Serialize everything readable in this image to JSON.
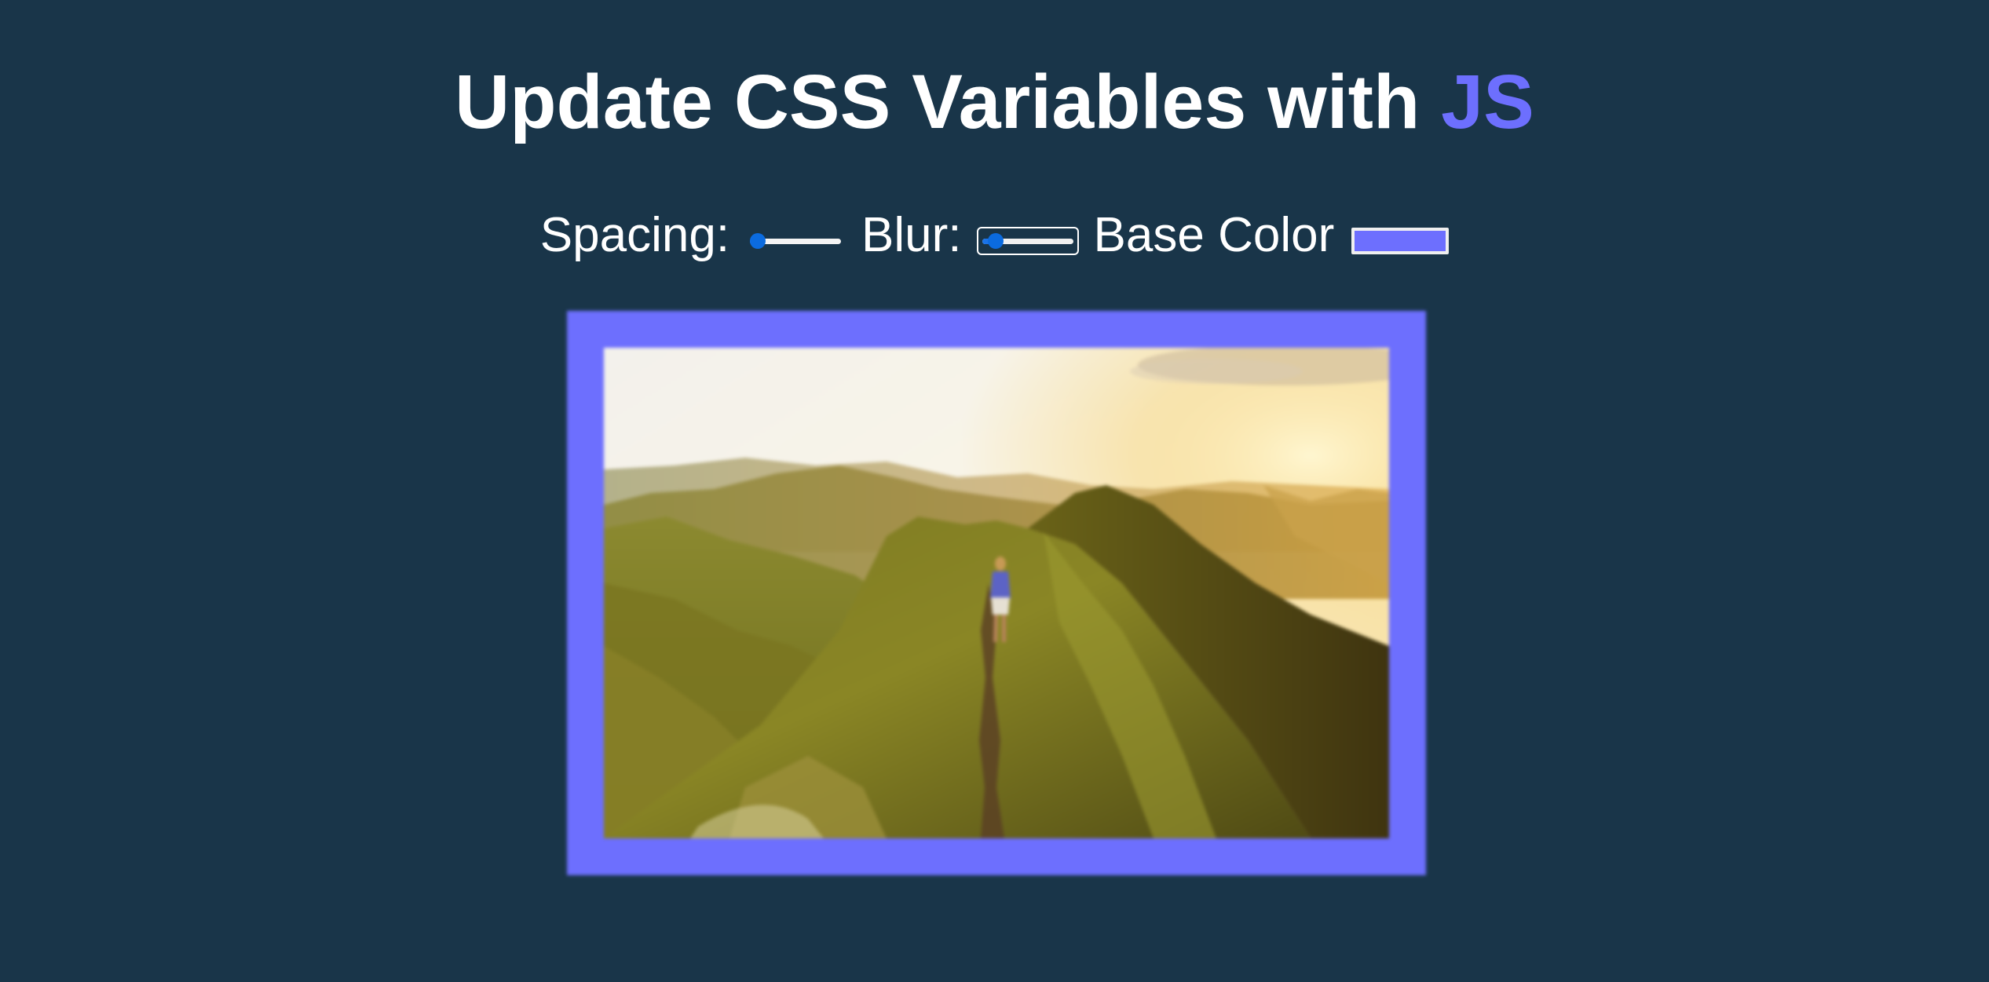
{
  "title": {
    "text": "Update CSS Variables with ",
    "highlight": "JS",
    "highlight_color": "#6d6ffe"
  },
  "controls": {
    "spacing": {
      "label": "Spacing:",
      "value": 10,
      "min": 10,
      "max": 200
    },
    "blur": {
      "label": "Blur:",
      "value": 2,
      "min": 0,
      "max": 25,
      "focused": true
    },
    "base_color": {
      "label": "Base Color",
      "value": "#6d6ffe"
    }
  },
  "image": {
    "subject": "hiker on a green mountain ridge at sunrise",
    "frame_color": "#6d6ffe"
  },
  "colors": {
    "background": "#193549",
    "text": "#ffffff",
    "slider_accent": "#0b6bdf"
  }
}
